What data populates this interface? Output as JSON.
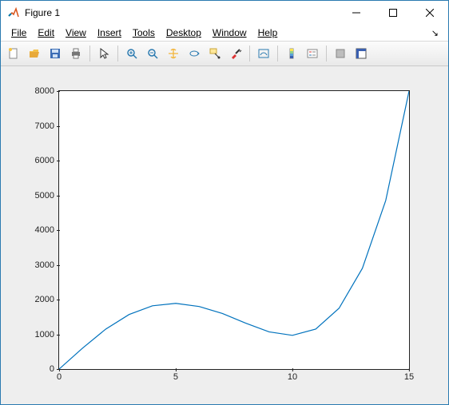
{
  "window": {
    "title": "Figure 1"
  },
  "menu": {
    "file": "File",
    "edit": "Edit",
    "view": "View",
    "insert": "Insert",
    "tools": "Tools",
    "desktop": "Desktop",
    "window": "Window",
    "help": "Help",
    "dock": "↘"
  },
  "toolbar_icons": {
    "new": "new-figure",
    "open": "open",
    "save": "save",
    "print": "print",
    "pointer": "pointer",
    "zoom_in": "zoom-in",
    "zoom_out": "zoom-out",
    "pan": "pan",
    "rotate": "rotate-3d",
    "datacursor": "data-cursor",
    "brush": "brush",
    "link": "link",
    "colorbar": "colorbar",
    "legend": "legend",
    "hide": "hide-tools",
    "show": "show-tools"
  },
  "chart_data": {
    "type": "line",
    "x": [
      0,
      1,
      2,
      3,
      4,
      5,
      6,
      7,
      8,
      9,
      10,
      11,
      12,
      13,
      14,
      15
    ],
    "y": [
      0,
      600,
      1150,
      1570,
      1820,
      1890,
      1800,
      1600,
      1320,
      1070,
      970,
      1150,
      1750,
      2900,
      4850,
      8000
    ],
    "xlim": [
      0,
      15
    ],
    "ylim": [
      0,
      8000
    ],
    "xticks": [
      0,
      5,
      10,
      15
    ],
    "yticks": [
      0,
      1000,
      2000,
      3000,
      4000,
      5000,
      6000,
      7000,
      8000
    ],
    "color": "#0072bd",
    "title": "",
    "xlabel": "",
    "ylabel": ""
  },
  "yticklabels": {
    "0": "0",
    "1": "1000",
    "2": "2000",
    "3": "3000",
    "4": "4000",
    "5": "5000",
    "6": "6000",
    "7": "7000",
    "8": "8000"
  },
  "xticklabels": {
    "0": "0",
    "1": "5",
    "2": "10",
    "3": "15"
  }
}
